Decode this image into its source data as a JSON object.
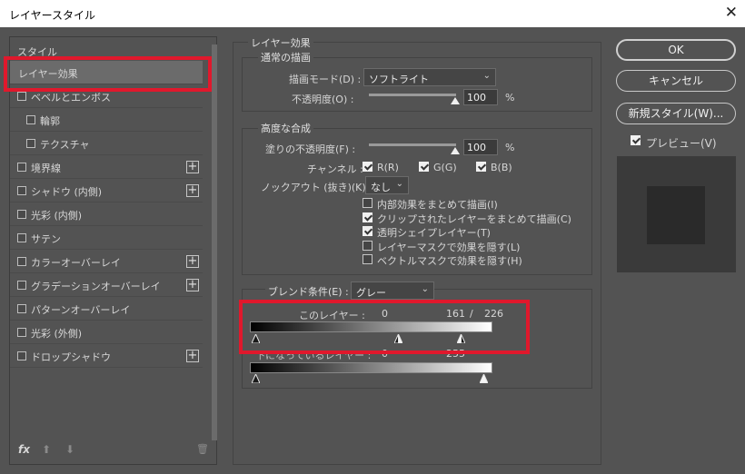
{
  "window": {
    "title": "レイヤースタイル",
    "close_glyph": "✕"
  },
  "styles": {
    "header": "スタイル",
    "items": [
      {
        "label": "レイヤー効果",
        "checkbox": false,
        "plus": false,
        "selected": true
      },
      {
        "label": "ベベルとエンボス",
        "checkbox": true,
        "plus": false
      },
      {
        "label": "輪郭",
        "checkbox": true,
        "plus": false,
        "indent": true
      },
      {
        "label": "テクスチャ",
        "checkbox": true,
        "plus": false,
        "indent": true
      },
      {
        "label": "境界線",
        "checkbox": true,
        "plus": true
      },
      {
        "label": "シャドウ (内側)",
        "checkbox": true,
        "plus": true
      },
      {
        "label": "光彩 (内側)",
        "checkbox": true,
        "plus": false
      },
      {
        "label": "サテン",
        "checkbox": true,
        "plus": false
      },
      {
        "label": "カラーオーバーレイ",
        "checkbox": true,
        "plus": true
      },
      {
        "label": "グラデーションオーバーレイ",
        "checkbox": true,
        "plus": true
      },
      {
        "label": "パターンオーバーレイ",
        "checkbox": true,
        "plus": false
      },
      {
        "label": "光彩 (外側)",
        "checkbox": true,
        "plus": false
      },
      {
        "label": "ドロップシャドウ",
        "checkbox": true,
        "plus": true
      }
    ],
    "footer": {
      "fx": "fx",
      "up": "⬆",
      "down": "⬇",
      "trash": "🗑"
    }
  },
  "layer_effects": {
    "group_title": "レイヤー効果",
    "normal": {
      "title": "通常の描画",
      "blend_mode_label": "描画モード(D) :",
      "blend_mode_value": "ソフトライト",
      "opacity_label": "不透明度(O) :",
      "opacity_value": "100",
      "opacity_unit": "%"
    },
    "advanced": {
      "title": "高度な合成",
      "fill_opacity_label": "塗りの不透明度(F) :",
      "fill_opacity_value": "100",
      "fill_opacity_unit": "%",
      "channels_label": "チャンネル :",
      "channel_r": "R(R)",
      "channel_g": "G(G)",
      "channel_b": "B(B)",
      "knockout_label": "ノックアウト (抜き)(K) :",
      "knockout_value": "なし",
      "options": [
        {
          "label": "内部効果をまとめて描画(I)",
          "checked": false
        },
        {
          "label": "クリップされたレイヤーをまとめて描画(C)",
          "checked": true
        },
        {
          "label": "透明シェイプレイヤー(T)",
          "checked": true
        },
        {
          "label": "レイヤーマスクで効果を隠す(L)",
          "checked": false
        },
        {
          "label": "ベクトルマスクで効果を隠す(H)",
          "checked": false
        }
      ]
    },
    "blend_if": {
      "label": "ブレンド条件(E) :",
      "value": "グレー",
      "this_layer_label": "このレイヤー :",
      "this_layer_black": "0",
      "this_layer_white_lo": "161",
      "this_layer_sep": "/",
      "this_layer_white_hi": "226",
      "underlying_label": "下になっているレイヤー :",
      "underlying_black": "0",
      "underlying_white": "255"
    }
  },
  "buttons": {
    "ok": "OK",
    "cancel": "キャンセル",
    "new_style": "新規スタイル(W)...",
    "preview_label": "プレビュー(V)"
  }
}
